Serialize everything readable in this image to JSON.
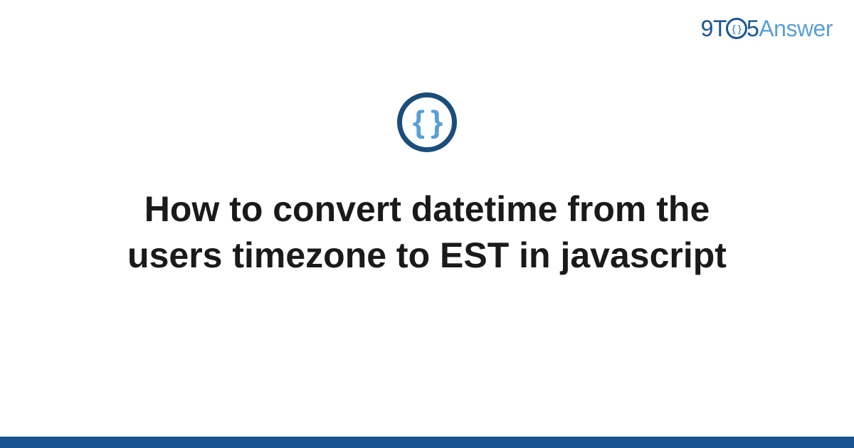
{
  "logo": {
    "part1": "9T",
    "circle_inner": "{ }",
    "part2": "5",
    "part3": "Answer"
  },
  "icon": {
    "name": "code-braces-icon",
    "glyph": "{ }"
  },
  "title": "How to convert datetime from the users timezone to EST in javascript"
}
